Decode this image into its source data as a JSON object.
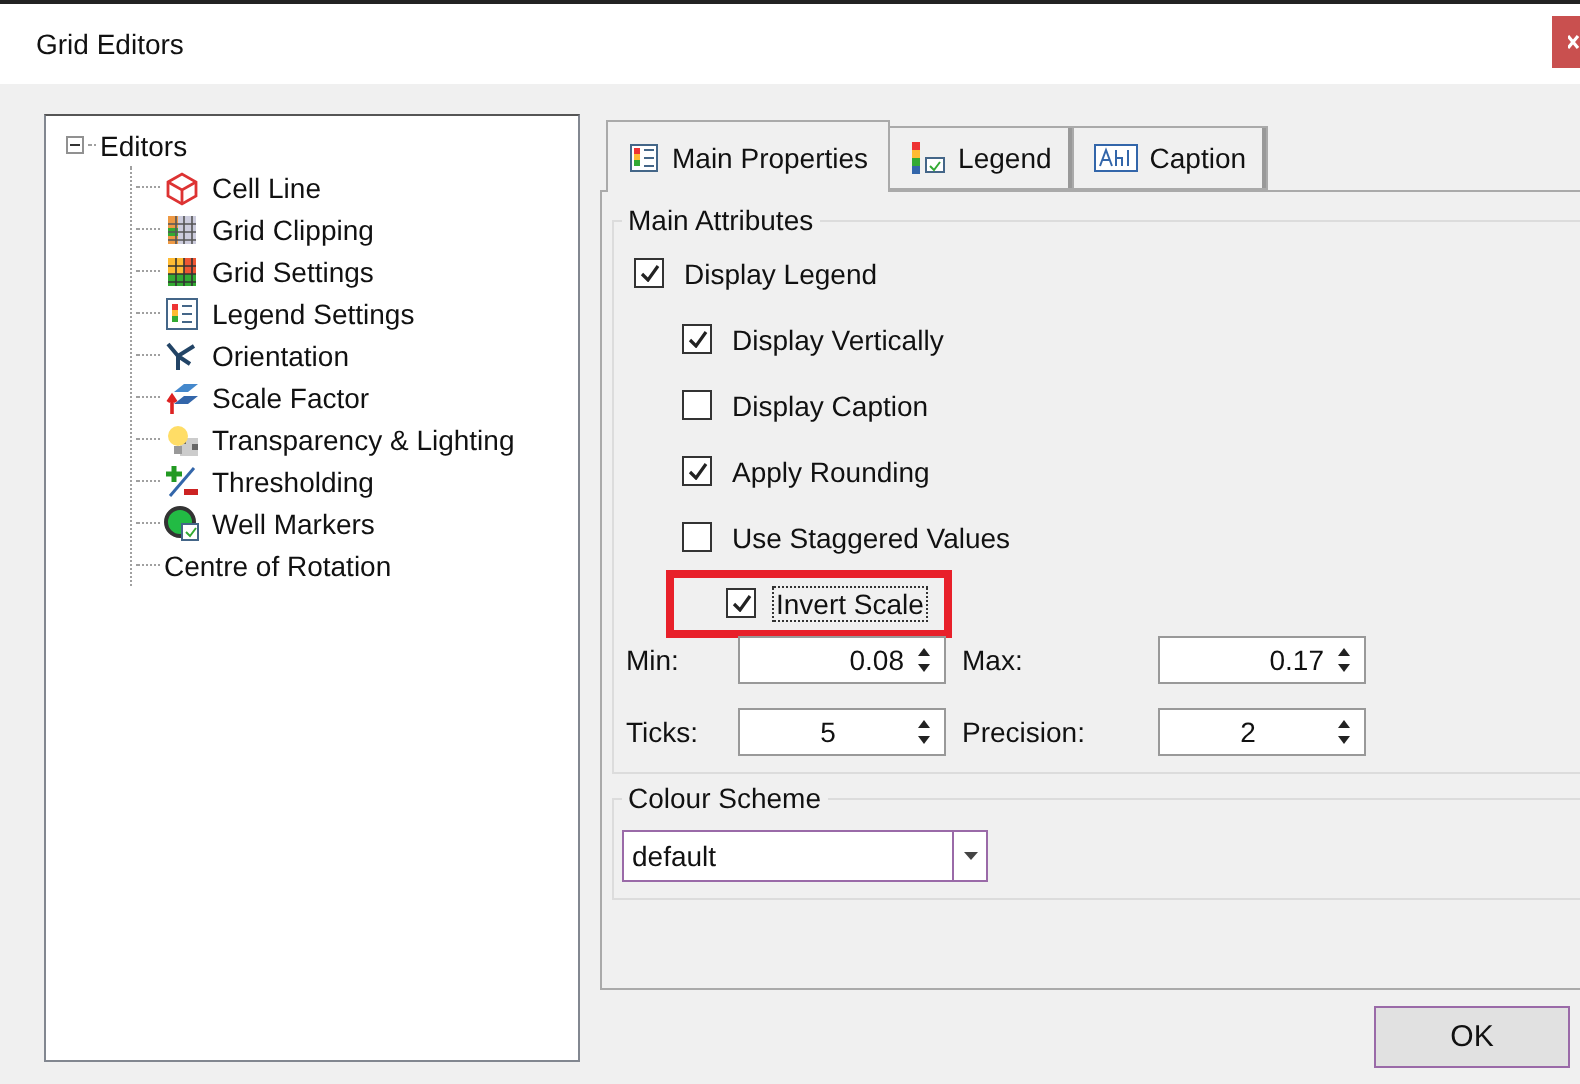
{
  "window": {
    "title": "Grid Editors"
  },
  "tree": {
    "label": "Editors",
    "expanded": true,
    "children": [
      {
        "label": "Cell Line"
      },
      {
        "label": "Grid Clipping"
      },
      {
        "label": "Grid Settings"
      },
      {
        "label": "Legend Settings"
      },
      {
        "label": "Orientation"
      },
      {
        "label": "Scale Factor"
      },
      {
        "label": "Transparency & Lighting"
      },
      {
        "label": "Thresholding"
      },
      {
        "label": "Well Markers"
      },
      {
        "label": "Centre of Rotation"
      }
    ]
  },
  "tabs": [
    {
      "label": "Main Properties",
      "selected": true
    },
    {
      "label": "Legend",
      "selected": false
    },
    {
      "label": "Caption",
      "selected": false
    }
  ],
  "main_attributes": {
    "title": "Main Attributes",
    "options": [
      {
        "label": "Display Legend",
        "checked": true,
        "highlighted": false,
        "children": [
          {
            "label": "Display Vertically",
            "checked": true,
            "highlighted": false
          },
          {
            "label": "Display Caption",
            "checked": false,
            "highlighted": false
          },
          {
            "label": "Apply Rounding",
            "checked": true,
            "highlighted": false
          },
          {
            "label": "Use Staggered Values",
            "checked": false,
            "highlighted": false
          },
          {
            "label": "Invert Scale",
            "checked": true,
            "highlighted": true
          }
        ]
      }
    ],
    "fields": [
      {
        "label": "Min:",
        "value": "0.08",
        "kind": "decimal"
      },
      {
        "label": "Max:",
        "value": "0.17",
        "kind": "decimal"
      },
      {
        "label": "Ticks:",
        "value": "5",
        "kind": "integer"
      },
      {
        "label": "Precision:",
        "value": "2",
        "kind": "integer"
      }
    ]
  },
  "colour_scheme": {
    "title": "Colour Scheme",
    "value": "default"
  },
  "buttons": [
    "OK"
  ]
}
